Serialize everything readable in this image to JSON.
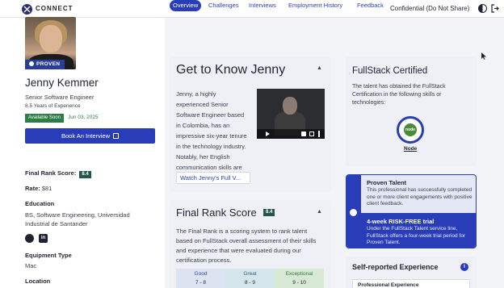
{
  "topbar": {
    "logo_text": "CONNECT",
    "confidential": "Confidential (Do Not Share)"
  },
  "profile": {
    "badge": "PROVEN",
    "name": "Jenny Kemmer",
    "title": "Senior Software Engineer",
    "years": "8.5 Years of Experience",
    "availability": "Available Soon",
    "available_date": "Jun 03, 2025",
    "book_button": "Book An Interview",
    "final_rank_label": "Final Rank Score:",
    "final_rank_value": "8.4",
    "rate_label": "Rate:",
    "rate_value": "$81",
    "education_label": "Education",
    "education_value": "BS, Software Engineering, Universidad Industrial de Santander",
    "linkedin_glyph": "in",
    "equipment_label": "Equipment Type",
    "equipment_value": "Mac",
    "location_label": "Location"
  },
  "tabs": [
    "Overview",
    "Challenges",
    "Interviews",
    "Employment History",
    "Feedback"
  ],
  "know": {
    "title": "Get to Know Jenny",
    "text": "Jenny, a highly experienced Senior Software Engineer based in Colombia, has an impressive six-year tenure in the technology industry. Notably, her English communication skills are excellent....",
    "watch_button": "Watch Jenny's Full V..."
  },
  "final_rank": {
    "title": "Final Rank Score",
    "value": "8.4",
    "text": "The Final Rank is a scoring system to rank talent based on FullStack overall assessment of their skills and experience that were evaluated during our certification process.",
    "scale": [
      {
        "label": "Good",
        "range": "7 - 8"
      },
      {
        "label": "Great",
        "range": "8 - 9"
      },
      {
        "label": "Exceptional",
        "range": "9 - 10"
      }
    ]
  },
  "certified": {
    "title": "FullStack Certified",
    "text": "The talent has obtained the FullStack Certification in the following skills or technologies:",
    "skill_icon_text": "node",
    "skill": "Node"
  },
  "proven": {
    "title": "Proven Talent",
    "text": "This professional has successfully completed one or more client engagements with positive client feedback.",
    "trial_title": "4-week RISK-FREE trial",
    "trial_text": "Under the FullStack Talent service line, FullStack offers a four-week trial period for Proven Talent."
  },
  "experience": {
    "title": "Self-reported Experience",
    "info_glyph": "i",
    "box_label": "Professional Experience"
  },
  "colors": {
    "primary": "#2a3db8",
    "available": "#2e7d46",
    "score_badge": "#24574a"
  }
}
